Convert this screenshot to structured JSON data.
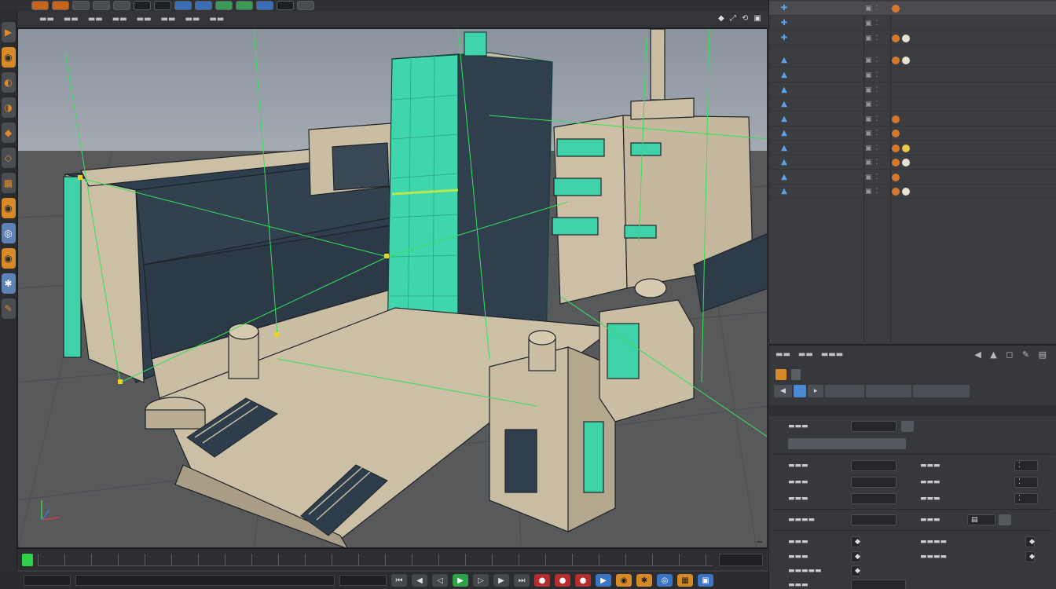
{
  "viewport": {
    "label": "",
    "corner_label": "",
    "nav_icons": "◆ ⤢ ⟲ ▣"
  },
  "timeline": {
    "frame_value": ""
  },
  "bottom_bar": {
    "field_left": "",
    "field_mid": "",
    "field_right": ""
  },
  "object_manager": {
    "objects": [
      {
        "name": "",
        "active": true
      },
      {
        "name": ""
      },
      {
        "name": ""
      },
      {
        "name": ""
      },
      {
        "name": ""
      },
      {
        "name": ""
      },
      {
        "name": ""
      },
      {
        "name": ""
      },
      {
        "name": ""
      },
      {
        "name": ""
      },
      {
        "name": ""
      },
      {
        "name": ""
      },
      {
        "name": ""
      }
    ]
  },
  "attribute_manager": {
    "nav_icons": "◀ ▲ ◻ ✎ ▤",
    "tabs": [
      {
        "label": "",
        "active": true
      },
      {
        "label": "▸"
      },
      {
        "label": ""
      },
      {
        "label": ""
      },
      {
        "label": ""
      }
    ],
    "section": "",
    "fields": {
      "mode_value": "",
      "mode_btn": "",
      "wide_btn": "",
      "v1": "",
      "v2": "",
      "v3": "",
      "v4": "",
      "btn_right": ""
    }
  }
}
